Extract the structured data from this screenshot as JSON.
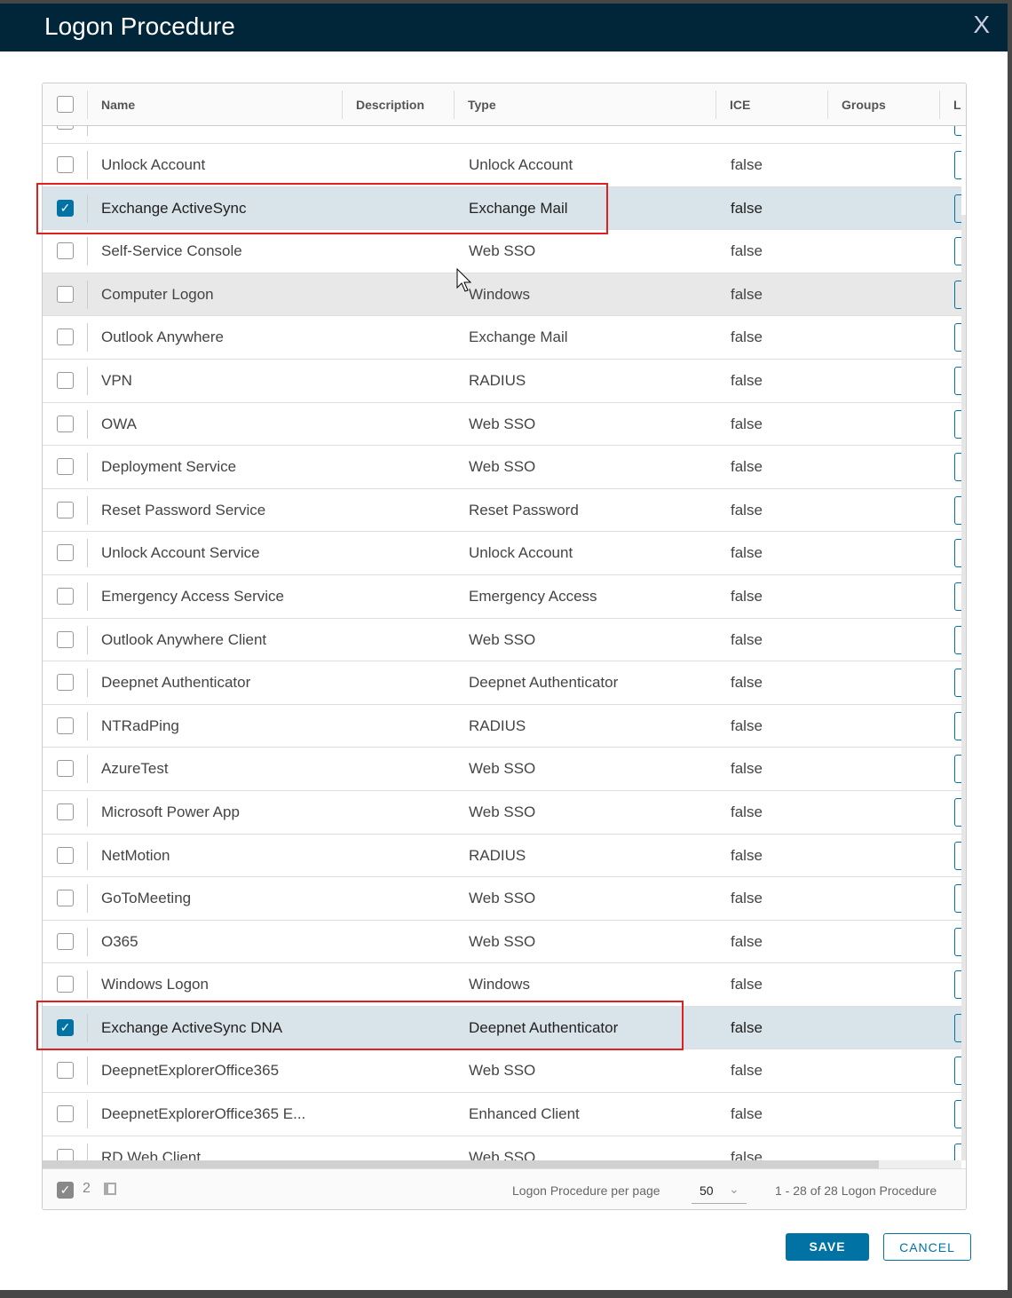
{
  "dialog": {
    "title": "Logon Procedure",
    "close_label": "X"
  },
  "columns": {
    "name": "Name",
    "description": "Description",
    "type": "Type",
    "ice": "ICE",
    "groups": "Groups",
    "l": "L"
  },
  "rows": [
    {
      "name": "",
      "type": "",
      "ice": "",
      "checked": false
    },
    {
      "name": "Unlock Account",
      "type": "Unlock Account",
      "ice": "false",
      "checked": false
    },
    {
      "name": "Exchange ActiveSync",
      "type": "Exchange Mail",
      "ice": "false",
      "checked": true
    },
    {
      "name": "Self-Service Console",
      "type": "Web SSO",
      "ice": "false",
      "checked": false
    },
    {
      "name": "Computer Logon",
      "type": "Windows",
      "ice": "false",
      "checked": false,
      "hover": true
    },
    {
      "name": "Outlook Anywhere",
      "type": "Exchange Mail",
      "ice": "false",
      "checked": false
    },
    {
      "name": "VPN",
      "type": "RADIUS",
      "ice": "false",
      "checked": false
    },
    {
      "name": "OWA",
      "type": "Web SSO",
      "ice": "false",
      "checked": false
    },
    {
      "name": "Deployment Service",
      "type": "Web SSO",
      "ice": "false",
      "checked": false
    },
    {
      "name": "Reset Password Service",
      "type": "Reset Password",
      "ice": "false",
      "checked": false
    },
    {
      "name": "Unlock Account Service",
      "type": "Unlock Account",
      "ice": "false",
      "checked": false
    },
    {
      "name": "Emergency Access Service",
      "type": "Emergency Access",
      "ice": "false",
      "checked": false
    },
    {
      "name": "Outlook Anywhere Client",
      "type": "Web SSO",
      "ice": "false",
      "checked": false
    },
    {
      "name": "Deepnet Authenticator",
      "type": "Deepnet Authenticator",
      "ice": "false",
      "checked": false
    },
    {
      "name": "NTRadPing",
      "type": "RADIUS",
      "ice": "false",
      "checked": false
    },
    {
      "name": "AzureTest",
      "type": "Web SSO",
      "ice": "false",
      "checked": false
    },
    {
      "name": "Microsoft Power App",
      "type": "Web SSO",
      "ice": "false",
      "checked": false
    },
    {
      "name": "NetMotion",
      "type": "RADIUS",
      "ice": "false",
      "checked": false
    },
    {
      "name": "GoToMeeting",
      "type": "Web SSO",
      "ice": "false",
      "checked": false
    },
    {
      "name": "O365",
      "type": "Web SSO",
      "ice": "false",
      "checked": false
    },
    {
      "name": "Windows Logon",
      "type": "Windows",
      "ice": "false",
      "checked": false
    },
    {
      "name": "Exchange ActiveSync DNA",
      "type": "Deepnet Authenticator",
      "ice": "false",
      "checked": true
    },
    {
      "name": "DeepnetExplorerOffice365",
      "type": "Web SSO",
      "ice": "false",
      "checked": false
    },
    {
      "name": "DeepnetExplorerOffice365 E...",
      "type": "Enhanced Client",
      "ice": "false",
      "checked": false
    },
    {
      "name": "RD Web Client",
      "type": "Web SSO",
      "ice": "false",
      "checked": false
    }
  ],
  "footer": {
    "selected_count": "2",
    "per_page_label": "Logon Procedure per page",
    "per_page": "50",
    "range": "1 - 28 of 28 Logon Procedure"
  },
  "buttons": {
    "save": "SAVE",
    "cancel": "CANCEL"
  },
  "colors": {
    "header": "#012639",
    "accent": "#0072a3",
    "highlight": "#e02020"
  }
}
